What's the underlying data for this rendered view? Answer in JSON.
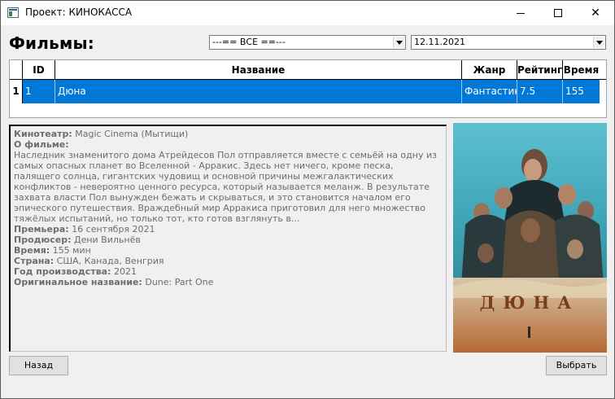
{
  "window": {
    "title": "Проект: КИНОКАССА"
  },
  "heading": "Фильмы:",
  "filters": {
    "genre_selected": "---== ВСЕ ==---",
    "date_selected": "12.11.2021"
  },
  "grid": {
    "columns": [
      "ID",
      "Название",
      "Жанр",
      "Рейтинг",
      "Время"
    ],
    "rows": [
      {
        "num": "1",
        "id": "1",
        "title": "Дюна",
        "genre": "Фантастика",
        "rating": "7.5",
        "duration": "155"
      }
    ]
  },
  "details": {
    "cinema_label": "Кинотеатр:",
    "cinema_value": "Magic Cinema (Мытищи)",
    "about_label": "О фильме:",
    "about_text": "Наследник знаменитого дома Атрейдесов Пол отправляется вместе с семьёй на одну из самых опасных планет во Вселенной - Арракис. Здесь нет ничего, кроме песка, палящего солнца, гигантских чудовищ и основной причины межгалактических конфликтов - невероятно ценного ресурса, который называется меланж. В результате захвата власти Пол вынужден бежать и скрываться, и это становится началом его эпического путешествия. Враждебный мир Арракиса приготовил для него множество тяжёлых испытаний, но только тот, кто готов взглянуть в...",
    "premiere_label": "Премьера:",
    "premiere_value": "16 сентября 2021",
    "producer_label": "Продюсер:",
    "producer_value": "Дени Вильнёв",
    "time_label": "Время:",
    "time_value": "155 мин",
    "country_label": "Страна:",
    "country_value": "США, Канада, Венгрия",
    "year_label": "Год производства:",
    "year_value": "2021",
    "original_label": "Оригинальное название:",
    "original_value": "Dune: Part One"
  },
  "poster": {
    "title_text": "ДЮНА"
  },
  "buttons": {
    "back": "Назад",
    "select": "Выбрать"
  },
  "colors": {
    "selection": "#0078d7",
    "window_bg": "#f0f0f0",
    "details_text": "#6d6d6d"
  }
}
